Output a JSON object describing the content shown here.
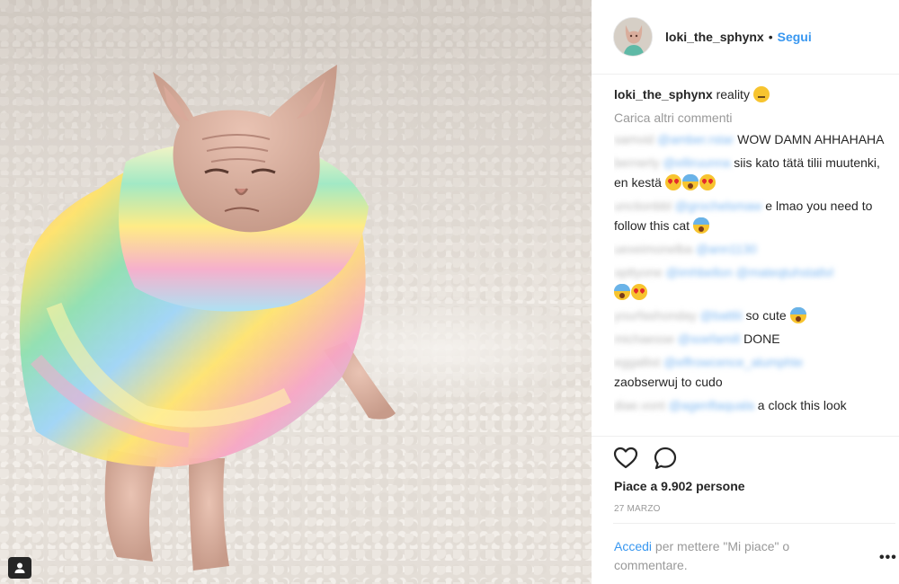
{
  "header": {
    "username": "loki_the_sphynx",
    "separator": "•",
    "follow_label": "Segui"
  },
  "caption": {
    "username": "loki_the_sphynx",
    "text": "reality",
    "emoji": "neutral-face"
  },
  "load_more_label": "Carica altri commenti",
  "comments": [
    {
      "user": "samvid",
      "mention": "@amber.rstar",
      "text": "WOW DAMN AHHAHAHA",
      "emojis": []
    },
    {
      "user": "bernerly",
      "mention": "@elliruunna",
      "text": "siis kato tätä tilii muutenki, en kestä",
      "emojis": [
        "heart-eyes",
        "scream",
        "heart-eyes"
      ]
    },
    {
      "user": "unctionbbl",
      "mention": "@grochelsmaw",
      "text": "e lmao you need to follow this cat",
      "emojis": [
        "scream"
      ]
    },
    {
      "user": "uexeimonelba",
      "mention": "@ann1130",
      "text": "",
      "emojis": []
    },
    {
      "user": "opttyone",
      "mention": "@imhbellon @mateqtuhstatlvl",
      "text": "",
      "emojis": [
        "scream",
        "heart-eyes"
      ]
    },
    {
      "user": "yourfashonday",
      "mention": "@battlii",
      "text": "so cute",
      "emojis": [
        "scream"
      ]
    },
    {
      "user": "michaesse",
      "mention": "@soefamill",
      "text": "DONE",
      "emojis": []
    },
    {
      "user": "eggallist",
      "mention": "@effrowcence_alumphte",
      "text": "zaobserwuj to cudo",
      "emojis": []
    },
    {
      "user": "diae.vont",
      "mention": "@agenftaquala",
      "text": "a clock this look",
      "emojis": []
    }
  ],
  "likes_label": "Piace a 9.902 persone",
  "date_label": "27 MARZO",
  "login": {
    "link_label": "Accedi",
    "text": "per mettere \"Mi piace\" o commentare."
  },
  "more_label": "•••",
  "icons": {
    "like": "heart-icon",
    "comment": "comment-bubble-icon",
    "user_tag": "user-tag-icon"
  },
  "colors": {
    "link": "#3897f0",
    "muted": "#999999",
    "text": "#262626",
    "divider": "#efefef"
  }
}
